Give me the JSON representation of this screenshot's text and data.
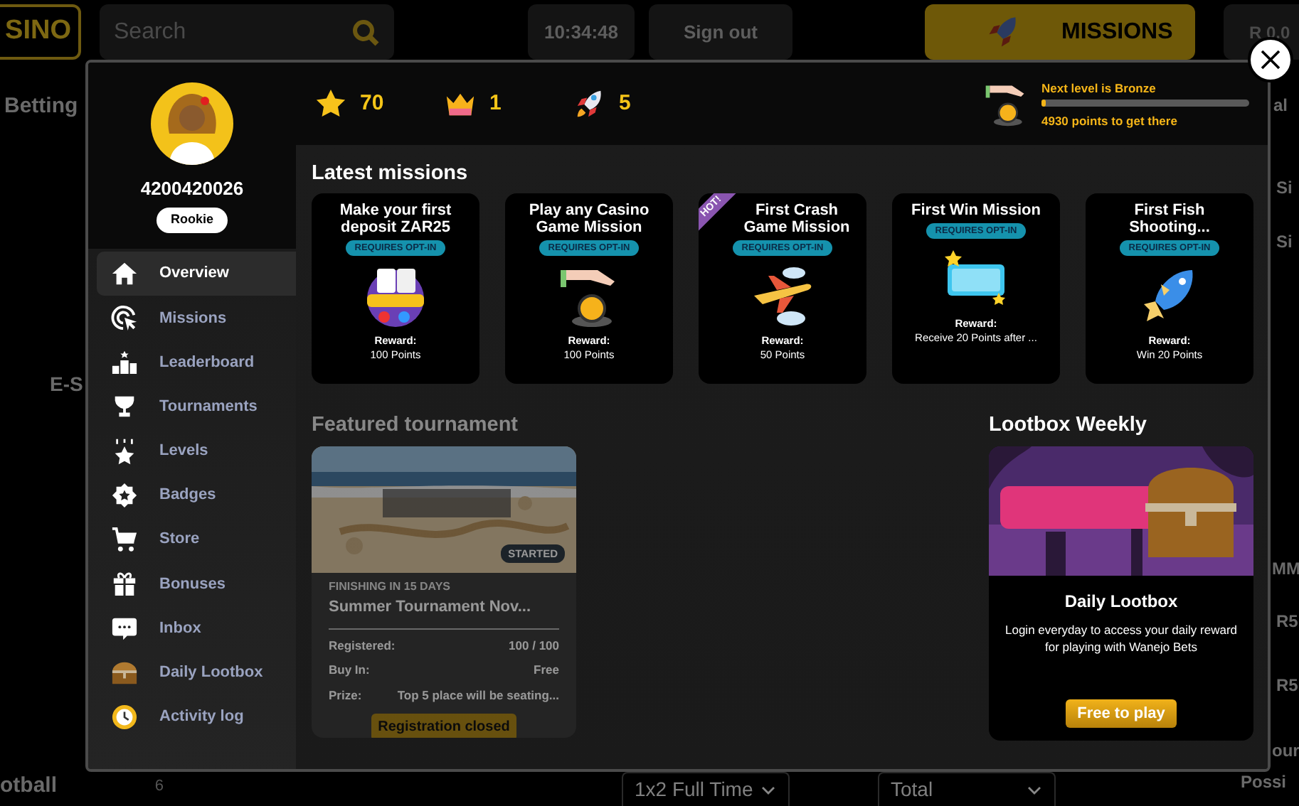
{
  "page": {
    "logo": "SINO",
    "search": {
      "placeholder": "Search"
    },
    "clock": "10:34:48",
    "sign_out": "Sign out",
    "missions_button": "MISSIONS",
    "balance": "R 0.0",
    "left_items": [
      "Betting",
      "E-S"
    ],
    "sport_row": {
      "name": "otball",
      "count": "6"
    },
    "right_items": [
      "al",
      "Si",
      "Si",
      "MM",
      "R5",
      "R5",
      "our",
      "Possi"
    ],
    "markets": [
      "1x2 Full Time",
      "Total"
    ]
  },
  "modal": {
    "user": {
      "id": "4200420026",
      "rank": "Rookie"
    },
    "menu": [
      {
        "label": "Overview",
        "selected": true
      },
      {
        "label": "Missions",
        "selected": false
      },
      {
        "label": "Leaderboard",
        "selected": false
      },
      {
        "label": "Tournaments",
        "selected": false
      },
      {
        "label": "Levels",
        "selected": false
      },
      {
        "label": "Badges",
        "selected": false
      },
      {
        "label": "Store",
        "selected": false
      },
      {
        "label": "Bonuses",
        "selected": false
      },
      {
        "label": "Inbox",
        "selected": false
      },
      {
        "label": "Daily Lootbox",
        "selected": false
      },
      {
        "label": "Activity log",
        "selected": false
      }
    ],
    "stats": [
      {
        "value": "70"
      },
      {
        "value": "1"
      },
      {
        "value": "5"
      }
    ],
    "level": {
      "next": "Next level is **Bronze**",
      "level": 0.02,
      "points": "**4930** points to get there"
    },
    "latest_missions": {
      "title": "Latest missions",
      "missions": [
        {
          "title": "Make your first deposit ZAR25",
          "tag": "REQUIRES OPT-IN",
          "reward_label": "Reward:",
          "reward": "100 Points"
        },
        {
          "title": "Play any Casino Game Mission",
          "tag": "REQUIRES OPT-IN",
          "reward_label": "Reward:",
          "reward": "100 Points"
        },
        {
          "title": "First Crash Game Mission",
          "ribbon": "HOT!",
          "tag": "REQUIRES OPT-IN",
          "reward_label": "Reward:",
          "reward": "50 Points"
        },
        {
          "title": "First Win Mission",
          "tag": "REQUIRES OPT-IN",
          "reward_label": "Reward:",
          "reward": "Receive 20 Points after ..."
        },
        {
          "title": "First Fish Shooting...",
          "tag": "REQUIRES OPT-IN",
          "reward_label": "Reward:",
          "reward": "Win 20 Points"
        }
      ]
    },
    "featured": {
      "title": "Featured tournament",
      "disabled": true,
      "status": "STARTED",
      "finishing": "FINISHING IN 15 DAYS",
      "name": "Summer Tournament Nov...",
      "rows": [
        {
          "label": "Registered:",
          "value": "100 / 100"
        },
        {
          "label": "Buy In:",
          "value": "Free"
        },
        {
          "label": "Prize:",
          "value": "Top 5 place will be seating..."
        }
      ],
      "button": "Registration closed"
    },
    "lootbox": {
      "title": "Lootbox Weekly",
      "name": "Daily Lootbox",
      "description": "Login everyday to access your daily reward for playing with Wanejo Bets",
      "button": "Free to play"
    }
  }
}
